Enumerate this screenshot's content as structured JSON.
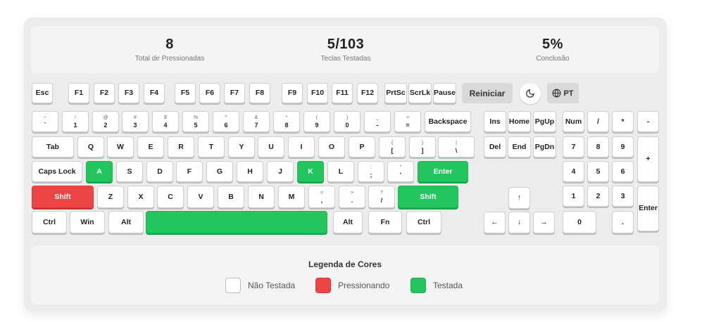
{
  "stats": [
    {
      "value": "8",
      "label": "Total de Pressionadas"
    },
    {
      "value": "5/103",
      "label": "Teclas Testadas"
    },
    {
      "value": "5%",
      "label": "Conclusão"
    }
  ],
  "controls": {
    "reset_label": "Reiniciar",
    "theme_icon": "moon-icon",
    "lang_label": "PT",
    "lang_icon": "globe-icon"
  },
  "colors": {
    "untested": "#ffffff",
    "pressed": "#ef4444",
    "tested": "#22c55e"
  },
  "keys": [
    {
      "id": "esc",
      "label": "Esc",
      "state": "untested"
    },
    {
      "id": "f1",
      "label": "F1",
      "state": "untested"
    },
    {
      "id": "f2",
      "label": "F2",
      "state": "untested"
    },
    {
      "id": "f3",
      "label": "F3",
      "state": "untested"
    },
    {
      "id": "f4",
      "label": "F4",
      "state": "untested"
    },
    {
      "id": "f5",
      "label": "F5",
      "state": "untested"
    },
    {
      "id": "f6",
      "label": "F6",
      "state": "untested"
    },
    {
      "id": "f7",
      "label": "F7",
      "state": "untested"
    },
    {
      "id": "f8",
      "label": "F8",
      "state": "untested"
    },
    {
      "id": "f9",
      "label": "F9",
      "state": "untested"
    },
    {
      "id": "f10",
      "label": "F10",
      "state": "untested"
    },
    {
      "id": "f11",
      "label": "F11",
      "state": "untested"
    },
    {
      "id": "f12",
      "label": "F12",
      "state": "untested"
    },
    {
      "id": "prtsc",
      "label": "PrtSc",
      "state": "untested"
    },
    {
      "id": "scrlk",
      "label": "ScrLk",
      "state": "untested"
    },
    {
      "id": "pause",
      "label": "Pause",
      "state": "untested"
    },
    {
      "id": "backquote",
      "label": "`",
      "shift": "~",
      "state": "untested"
    },
    {
      "id": "digit1",
      "label": "1",
      "shift": "!",
      "state": "untested"
    },
    {
      "id": "digit2",
      "label": "2",
      "shift": "@",
      "state": "untested"
    },
    {
      "id": "digit3",
      "label": "3",
      "shift": "#",
      "state": "untested"
    },
    {
      "id": "digit4",
      "label": "4",
      "shift": "$",
      "state": "untested"
    },
    {
      "id": "digit5",
      "label": "5",
      "shift": "%",
      "state": "untested"
    },
    {
      "id": "digit6",
      "label": "6",
      "shift": "^",
      "state": "untested"
    },
    {
      "id": "digit7",
      "label": "7",
      "shift": "&",
      "state": "untested"
    },
    {
      "id": "digit8",
      "label": "8",
      "shift": "*",
      "state": "untested"
    },
    {
      "id": "digit9",
      "label": "9",
      "shift": "(",
      "state": "untested"
    },
    {
      "id": "digit0",
      "label": "0",
      "shift": ")",
      "state": "untested"
    },
    {
      "id": "minus",
      "label": "-",
      "shift": "_",
      "state": "untested"
    },
    {
      "id": "equal",
      "label": "=",
      "shift": "+",
      "state": "untested"
    },
    {
      "id": "backspace",
      "label": "Backspace",
      "state": "untested"
    },
    {
      "id": "insert",
      "label": "Ins",
      "state": "untested"
    },
    {
      "id": "home",
      "label": "Home",
      "state": "untested"
    },
    {
      "id": "pgup",
      "label": "PgUp",
      "state": "untested"
    },
    {
      "id": "numlock",
      "label": "Num",
      "state": "untested"
    },
    {
      "id": "numdiv",
      "label": "/",
      "state": "untested"
    },
    {
      "id": "nummul",
      "label": "*",
      "state": "untested"
    },
    {
      "id": "numsub",
      "label": "-",
      "state": "untested"
    },
    {
      "id": "tab",
      "label": "Tab",
      "state": "untested"
    },
    {
      "id": "q",
      "label": "Q",
      "state": "untested"
    },
    {
      "id": "w",
      "label": "W",
      "state": "untested"
    },
    {
      "id": "e",
      "label": "E",
      "state": "untested"
    },
    {
      "id": "r",
      "label": "R",
      "state": "untested"
    },
    {
      "id": "t",
      "label": "T",
      "state": "untested"
    },
    {
      "id": "y",
      "label": "Y",
      "state": "untested"
    },
    {
      "id": "u",
      "label": "U",
      "state": "untested"
    },
    {
      "id": "i",
      "label": "I",
      "state": "untested"
    },
    {
      "id": "o",
      "label": "O",
      "state": "untested"
    },
    {
      "id": "p",
      "label": "P",
      "state": "untested"
    },
    {
      "id": "bracketleft",
      "label": "[",
      "shift": "{",
      "state": "untested"
    },
    {
      "id": "bracketright",
      "label": "]",
      "shift": "}",
      "state": "untested"
    },
    {
      "id": "backslash",
      "label": "\\",
      "shift": "|",
      "state": "untested"
    },
    {
      "id": "delete",
      "label": "Del",
      "state": "untested"
    },
    {
      "id": "end",
      "label": "End",
      "state": "untested"
    },
    {
      "id": "pgdn",
      "label": "PgDn",
      "state": "untested"
    },
    {
      "id": "num7",
      "label": "7",
      "state": "untested"
    },
    {
      "id": "num8",
      "label": "8",
      "state": "untested"
    },
    {
      "id": "num9",
      "label": "9",
      "state": "untested"
    },
    {
      "id": "numadd",
      "label": "+",
      "state": "untested"
    },
    {
      "id": "capslock",
      "label": "Caps Lock",
      "state": "untested"
    },
    {
      "id": "a",
      "label": "A",
      "state": "tested"
    },
    {
      "id": "s",
      "label": "S",
      "state": "untested"
    },
    {
      "id": "d",
      "label": "D",
      "state": "untested"
    },
    {
      "id": "f",
      "label": "F",
      "state": "untested"
    },
    {
      "id": "g",
      "label": "G",
      "state": "untested"
    },
    {
      "id": "h",
      "label": "H",
      "state": "untested"
    },
    {
      "id": "j",
      "label": "J",
      "state": "untested"
    },
    {
      "id": "k",
      "label": "K",
      "state": "tested"
    },
    {
      "id": "l",
      "label": "L",
      "state": "untested"
    },
    {
      "id": "semicolon",
      "label": ";",
      "shift": ":",
      "state": "untested"
    },
    {
      "id": "quote",
      "label": "'",
      "shift": "\"",
      "state": "untested"
    },
    {
      "id": "enter",
      "label": "Enter",
      "state": "tested"
    },
    {
      "id": "num4",
      "label": "4",
      "state": "untested"
    },
    {
      "id": "num5",
      "label": "5",
      "state": "untested"
    },
    {
      "id": "num6",
      "label": "6",
      "state": "untested"
    },
    {
      "id": "shiftleft",
      "label": "Shift",
      "state": "pressed"
    },
    {
      "id": "z",
      "label": "Z",
      "state": "untested"
    },
    {
      "id": "x",
      "label": "X",
      "state": "untested"
    },
    {
      "id": "c",
      "label": "C",
      "state": "untested"
    },
    {
      "id": "v",
      "label": "V",
      "state": "untested"
    },
    {
      "id": "b",
      "label": "B",
      "state": "untested"
    },
    {
      "id": "n",
      "label": "N",
      "state": "untested"
    },
    {
      "id": "m",
      "label": "M",
      "state": "untested"
    },
    {
      "id": "comma",
      "label": ",",
      "shift": "<",
      "state": "untested"
    },
    {
      "id": "period",
      "label": ".",
      "shift": ">",
      "state": "untested"
    },
    {
      "id": "slash",
      "label": "/",
      "shift": "?",
      "state": "untested"
    },
    {
      "id": "shiftright",
      "label": "Shift",
      "state": "tested"
    },
    {
      "id": "arrowup",
      "label": "↑",
      "state": "untested"
    },
    {
      "id": "num1",
      "label": "1",
      "state": "untested"
    },
    {
      "id": "num2",
      "label": "2",
      "state": "untested"
    },
    {
      "id": "num3",
      "label": "3",
      "state": "untested"
    },
    {
      "id": "numenter",
      "label": "Enter",
      "state": "untested"
    },
    {
      "id": "ctrlleft",
      "label": "Ctrl",
      "state": "untested"
    },
    {
      "id": "win",
      "label": "Win",
      "state": "untested"
    },
    {
      "id": "altleft",
      "label": "Alt",
      "state": "untested"
    },
    {
      "id": "space",
      "label": "",
      "state": "tested"
    },
    {
      "id": "altright",
      "label": "Alt",
      "state": "untested"
    },
    {
      "id": "fn",
      "label": "Fn",
      "state": "untested"
    },
    {
      "id": "ctrlright",
      "label": "Ctrl",
      "state": "untested"
    },
    {
      "id": "arrowleft",
      "label": "←",
      "state": "untested"
    },
    {
      "id": "arrowdown",
      "label": "↓",
      "state": "untested"
    },
    {
      "id": "arrowright",
      "label": "→",
      "state": "untested"
    },
    {
      "id": "num0",
      "label": "0",
      "state": "untested"
    },
    {
      "id": "numdecimal",
      "label": ".",
      "state": "untested"
    }
  ],
  "legend": {
    "title": "Legenda de Cores",
    "items": [
      {
        "label": "Não Testada",
        "state": "untested"
      },
      {
        "label": "Pressionando",
        "state": "pressed"
      },
      {
        "label": "Testada",
        "state": "tested"
      }
    ]
  }
}
